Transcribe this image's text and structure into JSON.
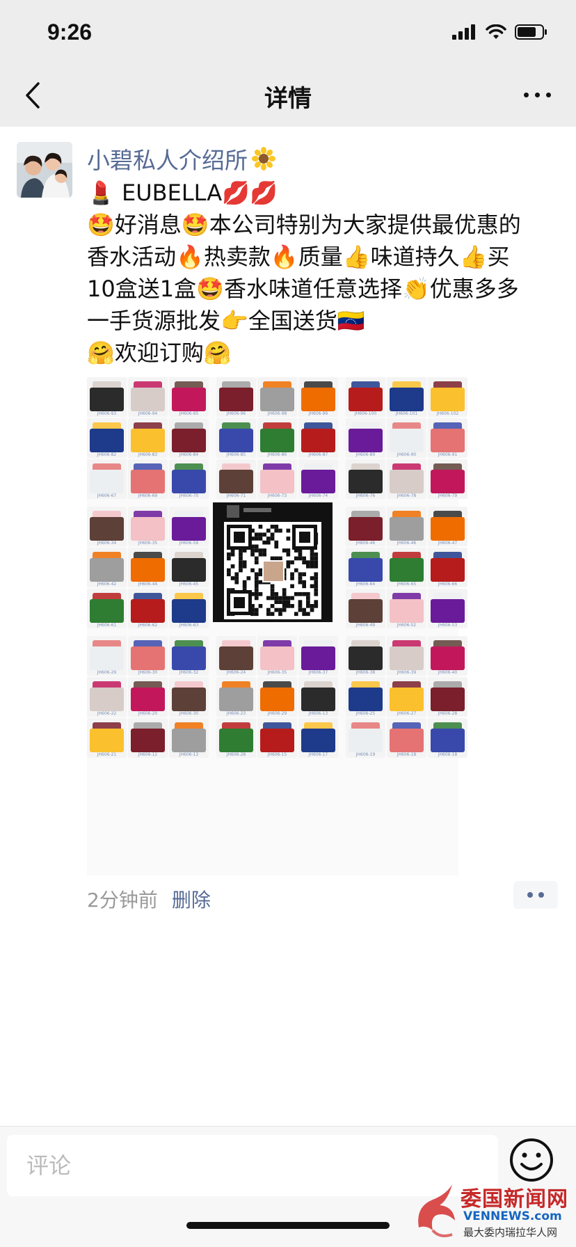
{
  "status_bar": {
    "time": "9:26"
  },
  "header": {
    "title": "详情"
  },
  "post": {
    "author": "小碧私人介绍所",
    "lines": [
      [
        "💄",
        " EUBELLA",
        "💋",
        "💋"
      ],
      [
        "🤩",
        "好消息",
        "🤩",
        "本公司特别为大家提供最优惠的"
      ],
      [
        "香水活动",
        "🔥",
        "热卖款",
        "🔥",
        "质量",
        "👍",
        "味道持久",
        "👍",
        "买"
      ],
      [
        "10盒送1盒",
        "🤩",
        "香水味道任意选择",
        "👏",
        "优惠多多"
      ],
      [
        "一手货源批发",
        "👉",
        "全国送货",
        "🇻🇪"
      ],
      [
        " ",
        "🤗",
        "欢迎订购",
        "🤗"
      ]
    ],
    "time": "2分钟前",
    "delete_label": "删除"
  },
  "product_image": {
    "codes": [
      "JH606-93",
      "JH606-94",
      "JH606-95",
      "JH606-82",
      "JH606-83",
      "JH606-84",
      "JH606-67",
      "JH606-69",
      "JH606-70",
      "JH606-96",
      "JH606-98",
      "JH606-99",
      "JH606-85",
      "JH606-86",
      "JH606-87",
      "JH606-71",
      "JH606-73",
      "JH606-74",
      "JH606-100",
      "JH606-101",
      "JH606-102",
      "JH606-89",
      "JH606-90",
      "JH606-91",
      "JH606-76",
      "JH606-78",
      "JH606-79",
      "JH606-34",
      "JH606-35",
      "JH606-59",
      "JH606-42",
      "JH606-44",
      "JH606-45",
      "JH606-61",
      "JH606-62",
      "JH606-63",
      "JH606-46",
      "JH606-46",
      "JH606-47",
      "JH606-64",
      "JH606-65",
      "JH606-66",
      "JH606-49",
      "JH606-52",
      "JH606-53",
      "JH606-29",
      "JH606-30",
      "JH606-32",
      "JH606-22",
      "JH606-20",
      "JH606-30",
      "JH606-21",
      "JH606-12",
      "JH606-13",
      "JH606-24",
      "JH606-35",
      "JH606-37",
      "JH606-23",
      "JH606-29",
      "JH606-13",
      "JH606-28",
      "JH606-15",
      "JH606-17",
      "JH606-38",
      "JH606-39",
      "JH606-40",
      "JH606-25",
      "JH606-27",
      "JH606-28",
      "JH606-19",
      "JH606-18",
      "JH606-18"
    ],
    "palette": [
      "#2b2b2b",
      "#7a1f2b",
      "#b71c1c",
      "#e57373",
      "#f3c1c6",
      "#d7ccc8",
      "#9e9e9e",
      "#1e3a8a",
      "#3949ab",
      "#6a1b9a",
      "#c2185b",
      "#ef6c00",
      "#fbc02d",
      "#2e7d32",
      "#eceff1",
      "#5d4037"
    ]
  },
  "comment": {
    "placeholder": "评论"
  },
  "watermark": {
    "title": "委国新闻网",
    "url": "VENNEWS.com",
    "subtitle": "最大委内瑞拉华人网"
  }
}
